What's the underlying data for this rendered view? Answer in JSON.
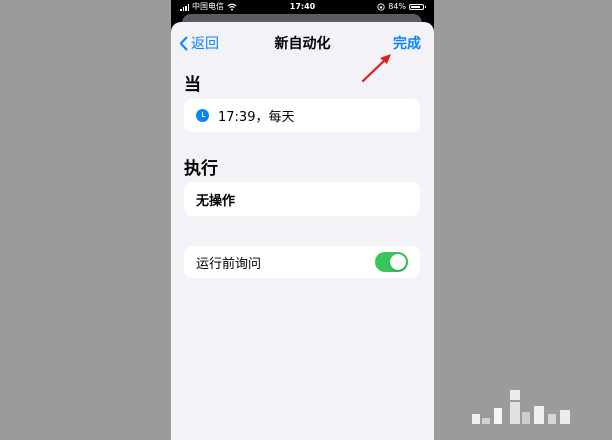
{
  "status_bar": {
    "carrier": "中国电信",
    "time": "17:40",
    "battery": "84%",
    "battery_level": 0.84
  },
  "nav": {
    "back_label": "返回",
    "title": "新自动化",
    "done_label": "完成"
  },
  "when": {
    "header": "当",
    "trigger_text": "17:39，每天"
  },
  "do": {
    "header": "执行",
    "action_text": "无操作"
  },
  "ask_before_running": {
    "label": "运行前询问",
    "enabled": true
  },
  "colors": {
    "accent": "#0a84ff",
    "toggle_on": "#34c759",
    "annotation_arrow": "#e0201f",
    "sheet_background": "#f2f2f7",
    "page_background": "#9b9b9b"
  },
  "icons": [
    "wifi-icon",
    "signal-icon",
    "lock-rotation-icon",
    "battery-icon",
    "chevron-left-icon",
    "clock-icon"
  ]
}
